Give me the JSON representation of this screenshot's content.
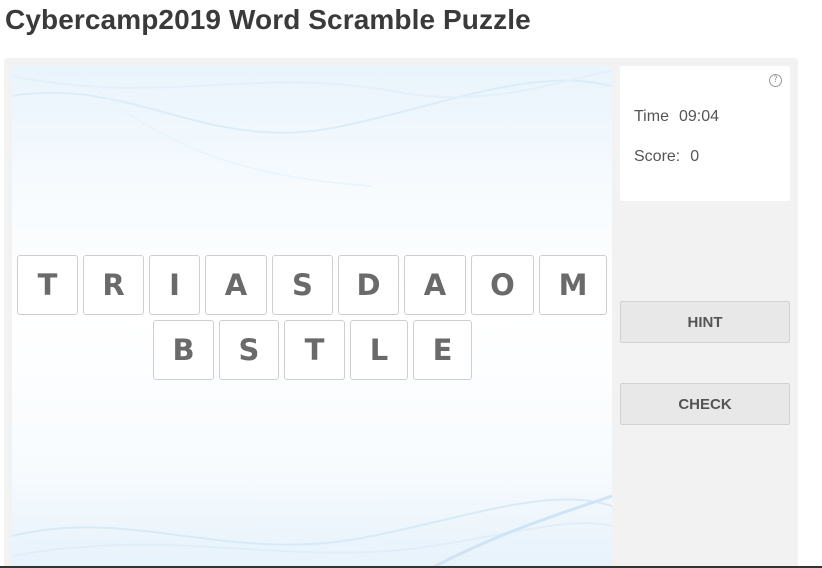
{
  "title": "Cybercamp2019 Word Scramble Puzzle",
  "info": {
    "time_label": "Time",
    "time_value": "09:04",
    "score_label": "Score:",
    "score_value": "0",
    "help_glyph": "?"
  },
  "buttons": {
    "hint_label": "HINT",
    "check_label": "CHECK"
  },
  "tiles": {
    "row1": [
      "T",
      "R",
      "I",
      "A",
      "S",
      "D",
      "A",
      "O",
      "M"
    ],
    "row2": [
      "B",
      "S",
      "T",
      "L",
      "E"
    ]
  },
  "colors": {
    "frame": "#f2f2f2",
    "tile_text": "#6a6a6a",
    "button_bg": "#e8e8e8"
  }
}
